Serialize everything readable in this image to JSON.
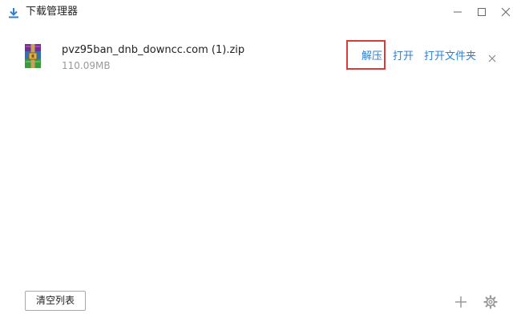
{
  "window": {
    "title": "下载管理器",
    "icons": {
      "title": "download-icon",
      "minimize": "minimize-icon",
      "maximize": "maximize-icon",
      "close": "close-icon"
    }
  },
  "downloads": [
    {
      "file_name": "pvz95ban_dnb_downcc.com (1).zip",
      "size": "110.09MB",
      "icon": "winrar-archive-icon",
      "actions": {
        "extract": "解压",
        "open": "打开",
        "open_folder": "打开文件夹"
      },
      "remove_icon": "close-icon",
      "highlighted_action": "extract"
    }
  ],
  "footer": {
    "clear_label": "清空列表",
    "add_icon": "plus-icon",
    "settings_icon": "gear-icon"
  },
  "colors": {
    "accent": "#2f7fd1",
    "highlight_border": "#d93a3a",
    "text": "#222222",
    "muted": "#9a9a9a",
    "icon_grey": "#8a8a8a"
  }
}
